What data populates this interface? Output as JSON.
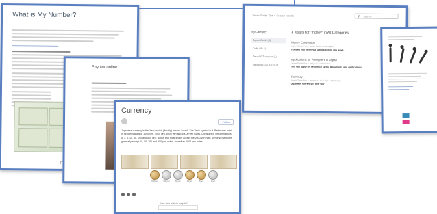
{
  "card_number": {
    "title": "What is My Number?",
    "subtitle": "",
    "footer_link": "[Translate]"
  },
  "card_pay": {
    "title": "Pay tax online",
    "subtitle": ""
  },
  "card_currency": {
    "title": "Currency",
    "author": "",
    "date": "",
    "follow_label": "Follow",
    "body": "Japanese currency is the 'Yen', which (literally) means 'round'. The Yen's symbol is ¥. Banknotes exist in denominations of 1000 yen, 2000 yen, 5000 yen and 10000 yen notes. Coins are in denominations of 1, 5, 10, 50, 100 and 500 yen. Banks and most shops accept the 2000 yen note. Vending machines generally accept 10, 50, 100 and 500 yen coins, as well as 1000 yen notes.",
    "coin_labels": [
      "500yen",
      "100yen",
      "50yen",
      "10yen",
      "5yen",
      "1yen"
    ],
    "helpful_text": "Was this article helpful?"
  },
  "card_search": {
    "breadcrumb": "Japan Guide Tips > Search results",
    "search_placeholder": "money",
    "sidebar_heading": "By Category",
    "sidebar_items": [
      "Japan Guide (4)",
      "Daily Life (1)",
      "Travel & Transport (1)",
      "Japanese Life & Tips (1)"
    ],
    "results_heading": "3 results for \"money\" in All Categories",
    "results": [
      {
        "title": "Money Conversion",
        "meta": "Japan Guide Tips > Japan Guide > Information",
        "desc": "Convert your money at a bank before you leave."
      },
      {
        "title": "Applications for Foreigners in Japan",
        "meta": "Japan Guide Tips > Daily Life > Information",
        "desc": "You can apply for residence cards. Documents and applications..."
      },
      {
        "title": "Currency",
        "meta": "Japan Guide Tips > Japanese Life & Tips > Information",
        "desc": "Japanese currency is the 'Yen'."
      }
    ]
  },
  "colors": {
    "card_border": "#5a7fc0",
    "accent": "#5a7fc0"
  }
}
